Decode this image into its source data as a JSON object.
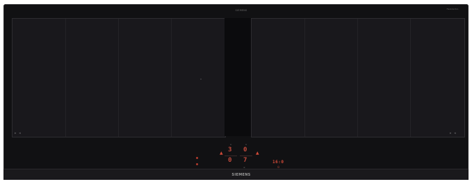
{
  "cooktop": {
    "top_label": "SIEMENS",
    "top_right_logo": "FlexInduction",
    "brand": "SIEMENS"
  },
  "zones": {
    "left": {
      "mark_left": "▸ ◂"
    },
    "right": {
      "mark_right": "▸ ◂"
    }
  },
  "controls": {
    "left_cluster": {
      "label_top": "A",
      "digit_top": "3",
      "digit_bottom": "0"
    },
    "right_cluster": {
      "label_top": "A",
      "digit_top": "0",
      "digit_bottom": "7"
    },
    "timer": {
      "value": "16:0"
    },
    "left_side_mark": "▲",
    "right_side_mark": "▲",
    "lock_icon": "≡",
    "power_icon": "⏻"
  },
  "colors": {
    "glass": "#111113",
    "zone": "#19181c",
    "accent_red": "#d24a38"
  }
}
